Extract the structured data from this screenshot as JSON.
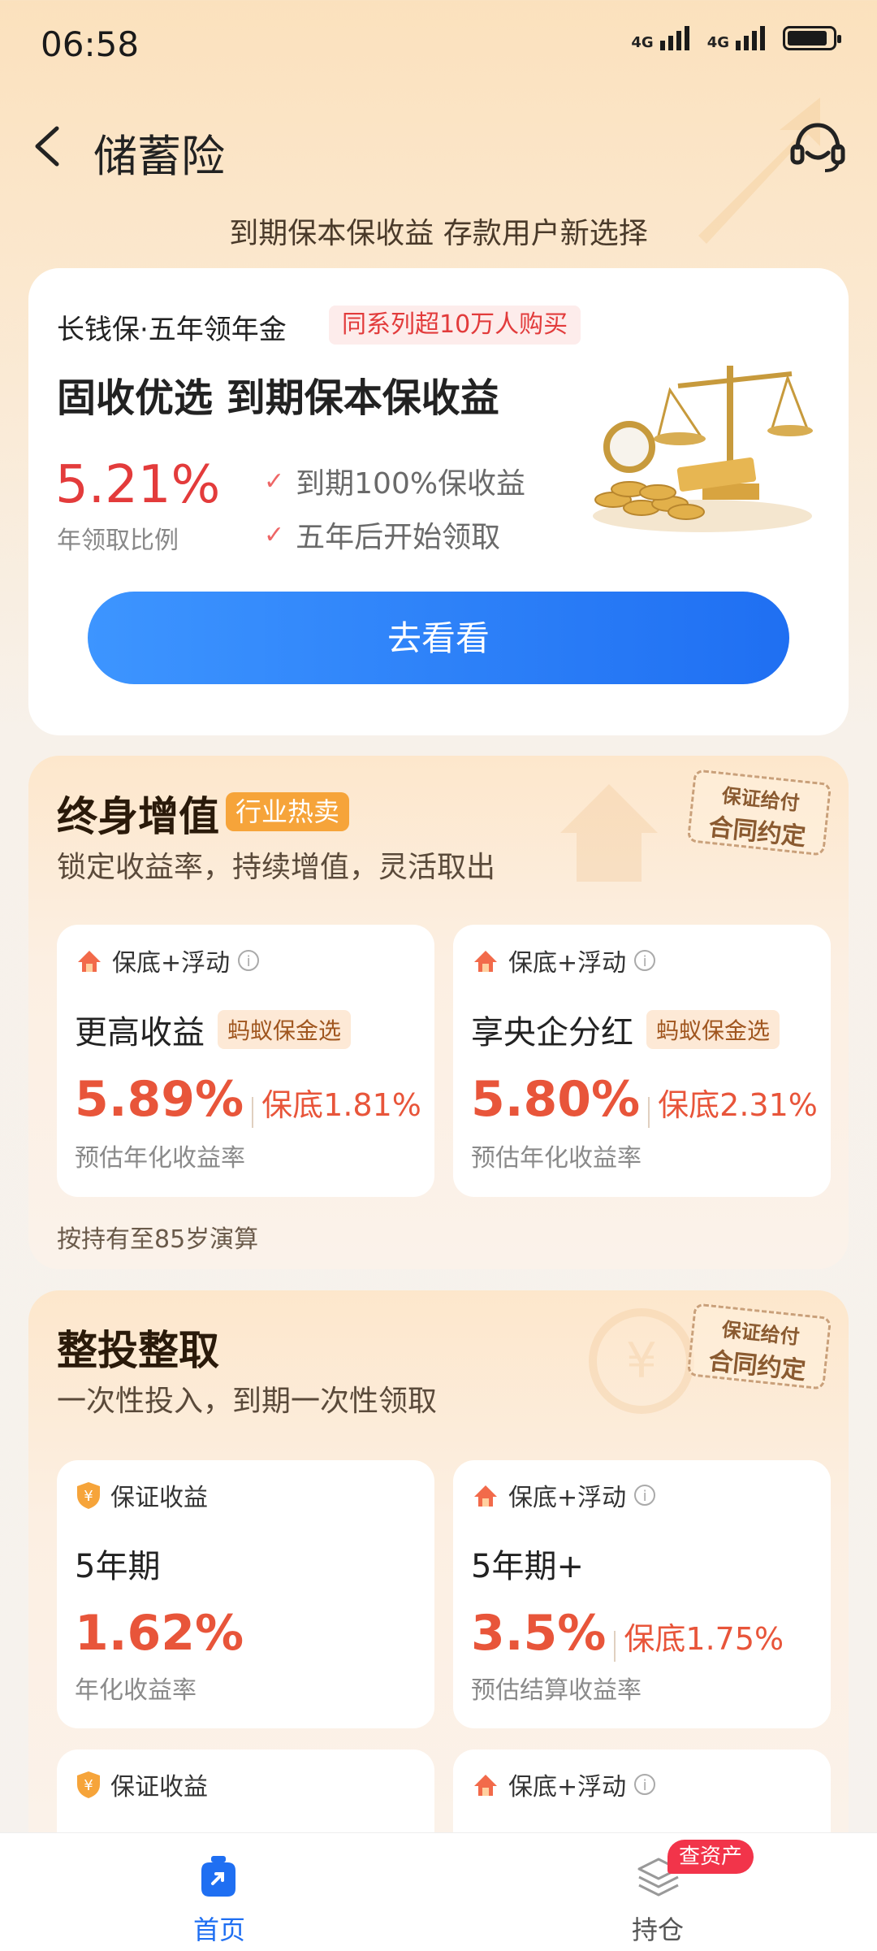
{
  "status_bar": {
    "time": "06:58",
    "signal1": "4G",
    "signal2": "4G",
    "battery_level": 0.8
  },
  "header": {
    "title": "储蓄险",
    "subtitle": "到期保本保收益 存款用户新选择",
    "back_icon": "chevron-left-icon",
    "service_icon": "customer-service-icon"
  },
  "featured": {
    "product_name": "长钱保·五年领年金",
    "badge": "同系列超10万人购买",
    "headline": "固收优选 到期保本保收益",
    "rate": "5.21%",
    "rate_label": "年领取比例",
    "features": [
      "到期100%保收益",
      "五年后开始领取"
    ],
    "button": "去看看"
  },
  "lifetime": {
    "title": "终身增值",
    "hot_tag": "行业热卖",
    "subtitle": "锁定收益率，持续增值，灵活取出",
    "stamp_line1": "保证给付",
    "stamp_line2": "合同约定",
    "note": "按持有至85岁演算",
    "products": [
      {
        "tag": "保底+浮动",
        "name": "更高收益",
        "label": "蚂蚁保金选",
        "rate": "5.89%",
        "floor": "保底1.81%",
        "desc": "预估年化收益率"
      },
      {
        "tag": "保底+浮动",
        "name": "享央企分红",
        "label": "蚂蚁保金选",
        "rate": "5.80%",
        "floor": "保底2.31%",
        "desc": "预估年化收益率"
      }
    ]
  },
  "lump": {
    "title": "整投整取",
    "subtitle": "一次性投入，到期一次性领取",
    "stamp_line1": "保证给付",
    "stamp_line2": "合同约定",
    "products": [
      {
        "tag": "保证收益",
        "name": "5年期",
        "rate": "1.62%",
        "desc": "年化收益率"
      },
      {
        "tag": "保底+浮动",
        "name": "5年期+",
        "rate": "3.5%",
        "floor": "保底1.75%",
        "desc": "预估结算收益率"
      },
      {
        "tag": "保证收益"
      },
      {
        "tag": "保底+浮动"
      }
    ]
  },
  "bottom_nav": {
    "home": "首页",
    "holdings": "持仓",
    "holdings_badge": "查资产"
  },
  "colors": {
    "accent_blue": "#1f6ff2",
    "rate_red": "#e33b3b",
    "rate_orange": "#e8553a",
    "hot_orange": "#f6a43a"
  }
}
